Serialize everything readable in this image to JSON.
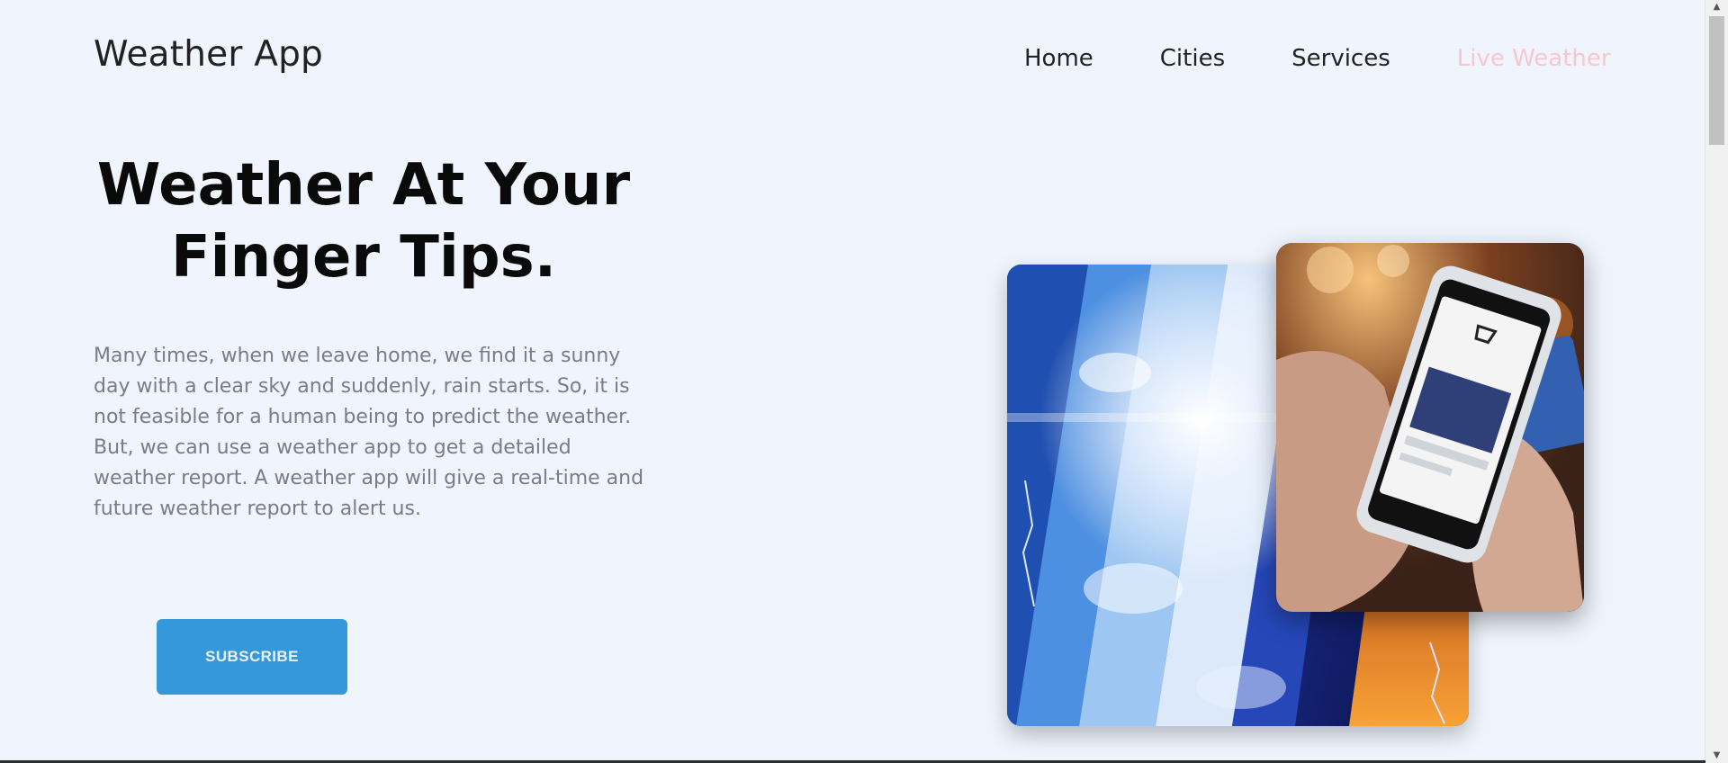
{
  "header": {
    "brand": "Weather App",
    "nav": [
      {
        "label": "Home"
      },
      {
        "label": "Cities"
      },
      {
        "label": "Services"
      },
      {
        "label": "Live Weather",
        "active": true
      }
    ]
  },
  "hero": {
    "title_line1": "Weather At Your",
    "title_line2": "Finger Tips.",
    "description": "Many times, when we leave home, we find it a sunny day with a clear sky and suddenly, rain starts. So, it is not feasible for a human being to predict the weather. But, we can use a weather app to get a detailed weather report. A weather app will give a real-time and future weather report to alert us.",
    "subscribe_label": "SUBSCRIBE"
  },
  "colors": {
    "background": "#f0f5fd",
    "accent": "#3498db",
    "active_nav": "#f6c7d1",
    "body_text": "#7b7b85"
  },
  "icons": {
    "scroll_up": "triangle-up-icon",
    "scroll_down": "triangle-down-icon"
  }
}
